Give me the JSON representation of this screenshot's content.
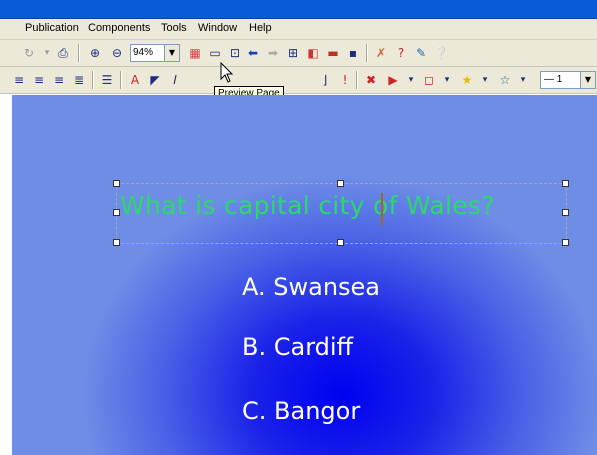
{
  "menu": [
    "Publication",
    "Components",
    "Tools",
    "Window",
    "Help"
  ],
  "toolbar": {
    "zoom_value": "94%",
    "line_value": "— 1",
    "tooltip": "Preview Page"
  },
  "slide": {
    "question": "What is capital city of Wales?",
    "answers": [
      "A. Swansea",
      "B. Cardiff",
      "C. Bangor"
    ]
  },
  "colors": {
    "question_text": "#2bd96b",
    "answer_text": "#ffffff",
    "background_center": "#0000f0",
    "background_edge": "#6e8ee6"
  }
}
